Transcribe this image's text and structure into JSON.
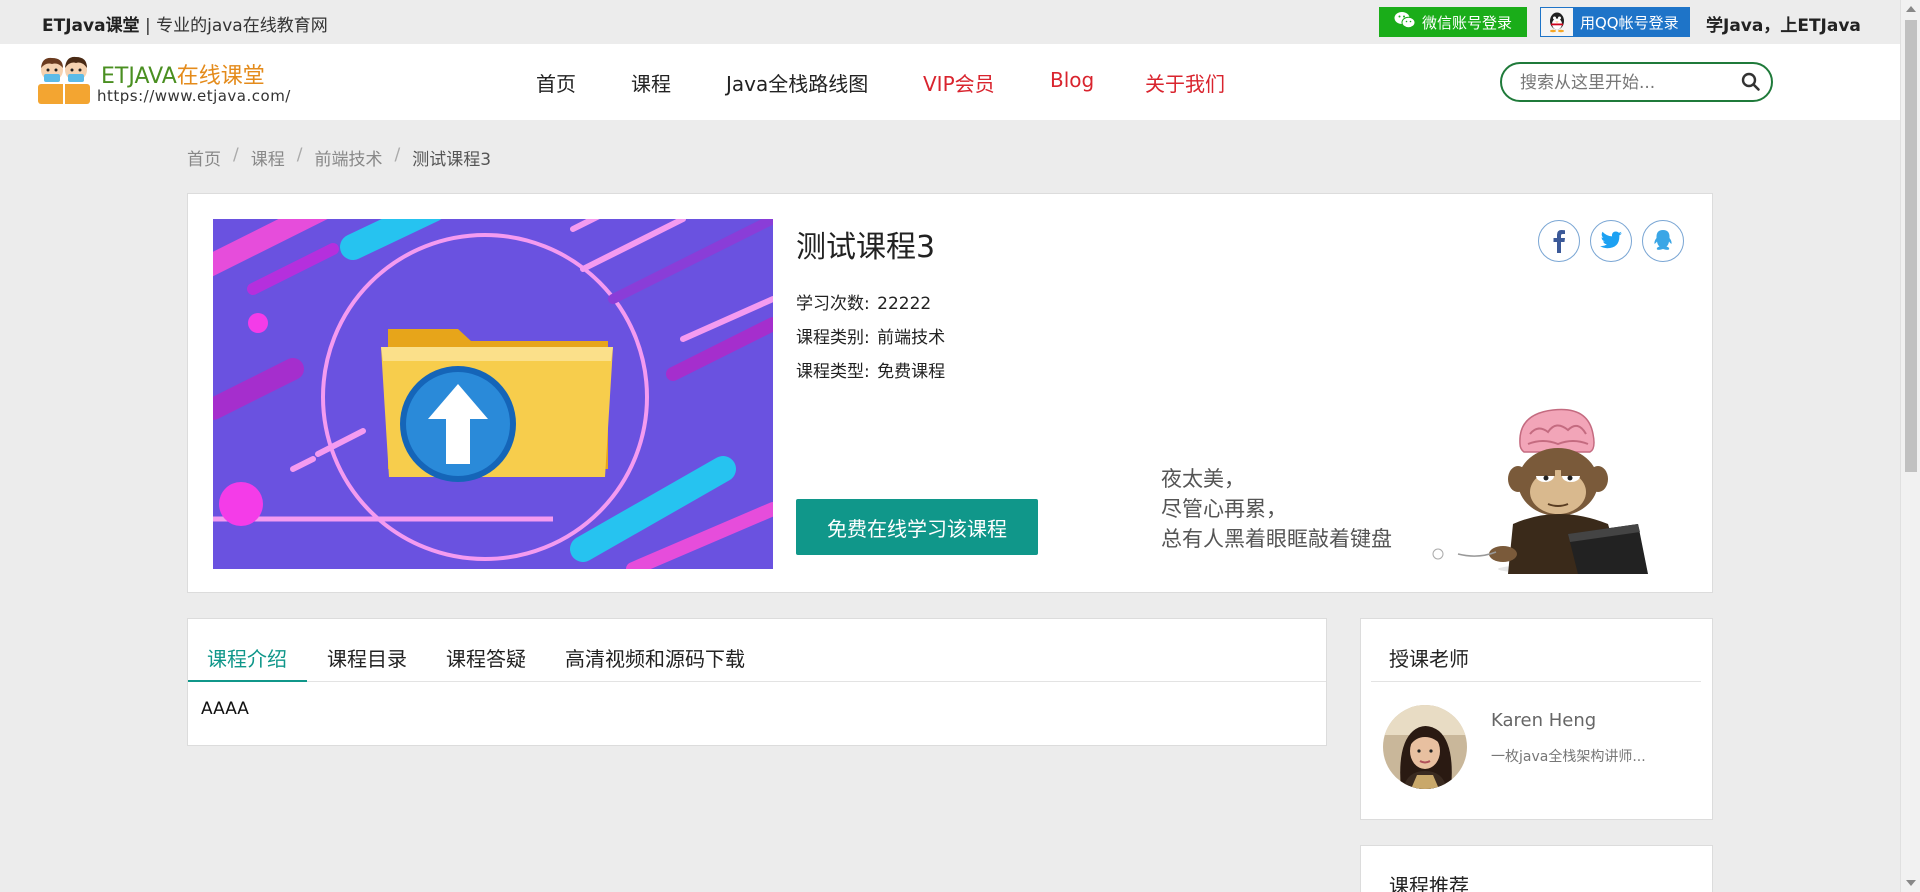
{
  "topbar": {
    "brand_bold": "ETJava课堂",
    "brand_rest": " | 专业的java在线教育网",
    "wechat_login": "微信账号登录",
    "qq_login": "用QQ帐号登录",
    "slogan": "学Java，上ETJava"
  },
  "logo": {
    "title_en": "ETJAVA",
    "title_cn": "在线课堂",
    "url": "https://www.etjava.com/"
  },
  "nav": {
    "items": [
      "首页",
      "课程",
      "Java全栈路线图",
      "VIP会员",
      "Blog",
      "关于我们"
    ]
  },
  "search": {
    "placeholder": "搜索从这里开始..."
  },
  "breadcrumb": {
    "items": [
      "首页",
      "课程",
      "前端技术",
      "测试课程3"
    ],
    "separator": "/"
  },
  "course": {
    "title": "测试课程3",
    "study_count_label": "学习次数:",
    "study_count": "22222",
    "category_label": "课程类别:",
    "category": "前端技术",
    "type_label": "课程类型:",
    "type": "免费课程",
    "study_button": "免费在线学习该课程",
    "share_icons": [
      "facebook-icon",
      "twitter-icon",
      "qq-icon"
    ],
    "promo_lines": [
      "夜太美，",
      "尽管心再累，",
      "总有人黑着眼眶敲着键盘"
    ]
  },
  "tabs": {
    "items": [
      "课程介绍",
      "课程目录",
      "课程答疑",
      "高清视频和源码下载"
    ],
    "active": "课程介绍",
    "content": "AAAA"
  },
  "teacher": {
    "heading": "授课老师",
    "name": "Karen Heng",
    "desc": "一枚java全栈架构讲师..."
  },
  "recommend": {
    "heading": "课程推荐"
  },
  "colors": {
    "accent": "#10978a",
    "wechat": "#1aad19",
    "qq": "#1e74c8",
    "nav_red": "#d9242e",
    "search_border": "#1f7a3a"
  }
}
